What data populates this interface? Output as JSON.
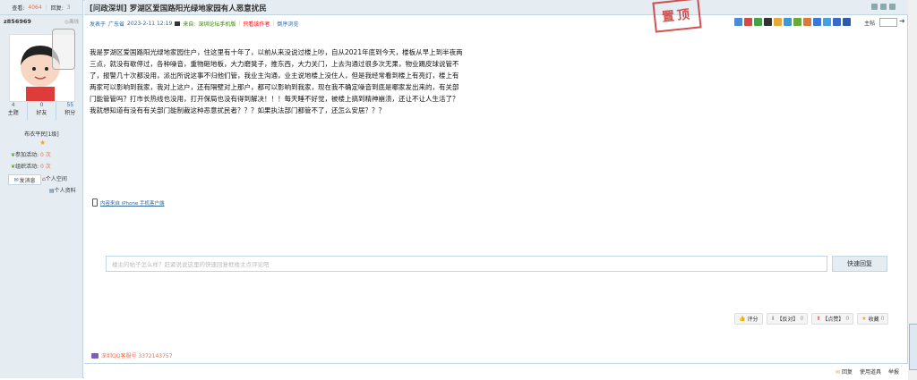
{
  "left": {
    "views_label": "查看:",
    "views": "4064",
    "replies_label": "回复:",
    "replies": "3",
    "username": "z856969",
    "offline": "离线",
    "stats": [
      {
        "num": "4",
        "label": "主题"
      },
      {
        "num": "0",
        "label": "好友"
      },
      {
        "num": "55",
        "label": "积分"
      }
    ],
    "rank": "布衣平民[1级]",
    "activity_join_label": "参加活动:",
    "activity_join_num": "0 次",
    "activity_org_label": "组织活动:",
    "activity_org_num": "0 次",
    "send_msg": "发消息",
    "personal_space": "个人空间",
    "personal_profile": "个人资料"
  },
  "header": {
    "type": "[问政深圳]",
    "title": "罗湖区爱国路阳光绿地家园有人恶意扰民",
    "stamp": "置顶",
    "posted_label": "发表于",
    "location": "广东省",
    "date": "2023-2-11 12:19",
    "from_label": "来自:",
    "from": "深圳论坛手机版",
    "only_author": "只看该作者",
    "reverse": "倒序浏览",
    "floor_label": "主帖"
  },
  "post": {
    "content": "我是罗湖区爱国路阳光绿地家园住户，住这里有十年了，以前从来没说过楼上吵，自从2021年底到今天，楼板从早上到半夜两三点，就没有歇停过，各种噪音，重物砸地板，大力磨凳子，推东西，大力关门，上去沟通过很多次无果，物业踢皮球说管不了，报警几十次都没用，派出所说这事不归他们管，我业主沟通，业主说地楼上没住人，但是我经常看到楼上有亮灯，楼上有两家可以影响到我家，我对上这户，还有隔壁对上那户，都可以影响到我家，现在我不确定噪音到底是哪家发出来的，有关部门能管管吗？打市长热线也没用，打开保局也没有得到解决！！！每天睡不好觉，被楼上搞到精神崩溃，还让不让人生活了？我就想知道有没有有关部门能制裁这种恶意扰民者？？？如果执法部门都管不了，还怎么安居？？？",
    "iphone_source": "内容来自 iPhone 手机客户端",
    "reply_placeholder": "楼主的帖子怎么样？赶紧说说这里的快速回复框楼主点评论吧",
    "reply_button": "快速回复"
  },
  "actions": [
    {
      "label": "评分",
      "count": ""
    },
    {
      "label": "【反对】",
      "count": "0"
    },
    {
      "label": "【点赞】",
      "count": "0"
    },
    {
      "label": "收藏",
      "count": "0"
    }
  ],
  "qq": "深圳QQ客服号 3372143757",
  "footer": {
    "reply": "回复",
    "tools": "使用道具",
    "report": "举报"
  },
  "colors": {
    "border": "#c2d5e3",
    "panel": "#e5edf2",
    "accent": "#f26c4f",
    "link": "#336699"
  }
}
